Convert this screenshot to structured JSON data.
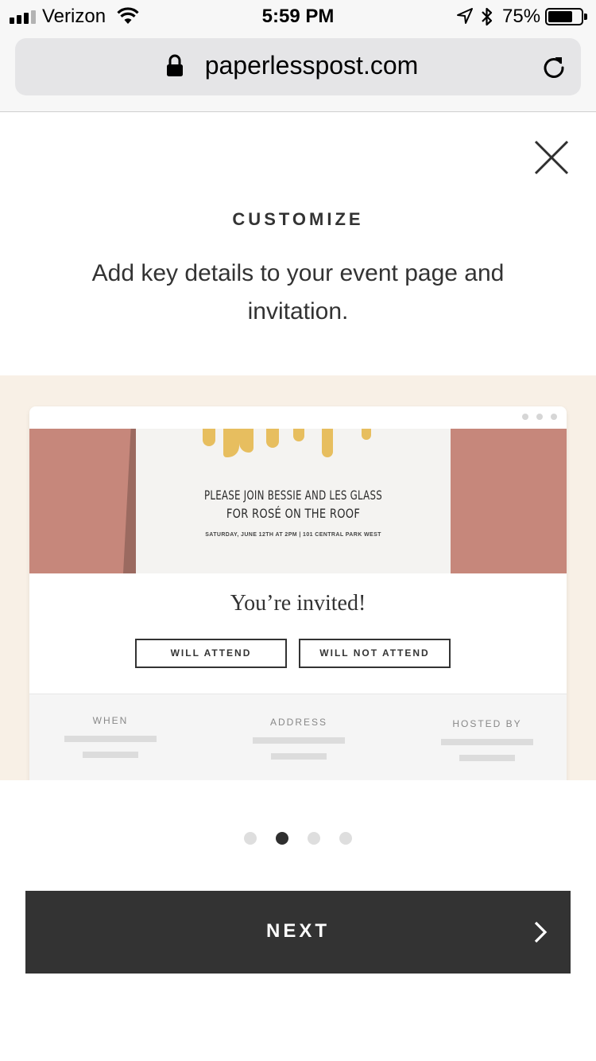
{
  "status_bar": {
    "carrier": "Verizon",
    "time": "5:59 PM",
    "battery_percent": "75%",
    "battery_level": 0.75,
    "signal_bars": 4,
    "signal_active": 3
  },
  "browser": {
    "url": "paperlesspost.com",
    "lock_icon": "lock-icon",
    "reload_icon": "reload-icon"
  },
  "onboarding": {
    "close_icon": "close-icon",
    "heading": "CUSTOMIZE",
    "subtext": "Add key details to your event page and invitation.",
    "current_step": 2,
    "total_steps": 4,
    "next_label": "NEXT",
    "next_icon": "chevron-right-icon"
  },
  "preview": {
    "invite_line1": "PLEASE JOIN BESSIE AND LES GLASS",
    "invite_line2": "FOR ROSÉ ON THE ROOF",
    "invite_details": "SATURDAY, JUNE 12TH AT 2PM | 101 CENTRAL PARK WEST",
    "invited_title": "You’re invited!",
    "attend_label": "WILL ATTEND",
    "not_attend_label": "WILL NOT ATTEND",
    "detail_labels": [
      "WHEN",
      "ADDRESS",
      "HOSTED BY"
    ]
  },
  "colors": {
    "hero": "#c6877b",
    "preview_bg": "#f8f0e6",
    "button_dark": "#333333",
    "gold": "#e7be5f"
  }
}
